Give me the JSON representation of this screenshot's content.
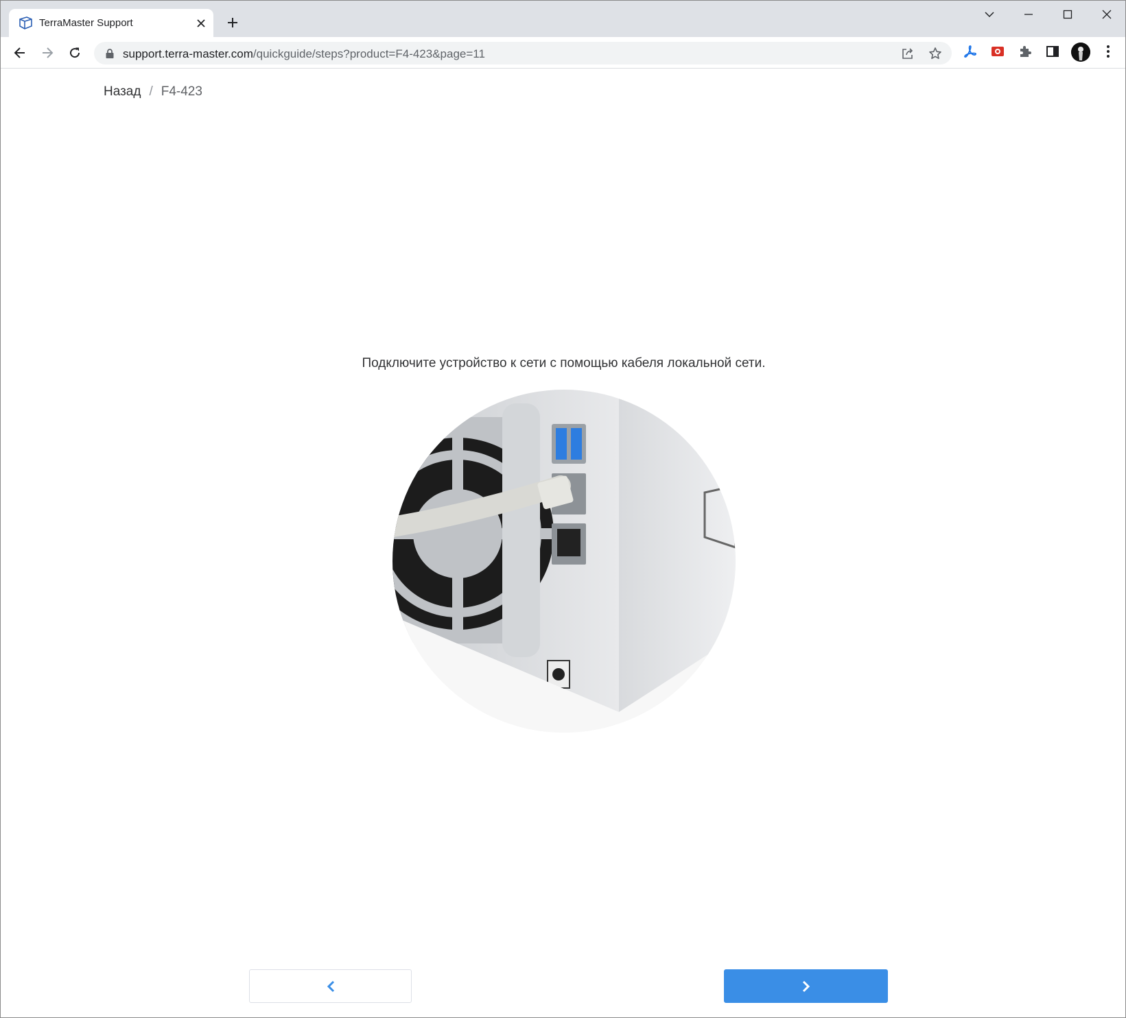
{
  "browser": {
    "tab": {
      "title": "TerraMaster Support"
    },
    "address_bar": {
      "host": "support.terra-master.com",
      "path": "/quickguide/steps?product=F4-423&page=11"
    },
    "icons": {
      "favicon": "terramaster-favicon-icon",
      "tab_close": "close-icon",
      "new_tab": "plus-icon",
      "tab_search": "chevron-down-icon",
      "minimize": "minimize-icon",
      "maximize": "maximize-icon",
      "window_close": "close-icon",
      "back": "arrow-left-icon",
      "forward": "arrow-right-icon",
      "reload": "reload-icon",
      "lock": "lock-icon",
      "share": "share-icon",
      "bookmark": "star-icon",
      "acrobat": "acrobat-icon",
      "screen_recorder": "screen-recorder-icon",
      "extensions": "puzzle-icon",
      "side_panel": "side-panel-icon",
      "menu": "kebab-menu-icon"
    },
    "colors": {
      "tabstrip": "#dee1e6",
      "omnibox": "#f1f3f4"
    }
  },
  "page": {
    "breadcrumb": {
      "back_label": "Назад",
      "separator": "/",
      "current": "F4-423"
    },
    "instruction": "Подключите устройство к сети с помощью кабеля локальной сети.",
    "navigation": {
      "prev_icon": "chevron-left-icon",
      "next_icon": "chevron-right-icon"
    },
    "colors": {
      "primary": "#3a8ee6",
      "prev_icon": "#3a8ee6"
    }
  }
}
